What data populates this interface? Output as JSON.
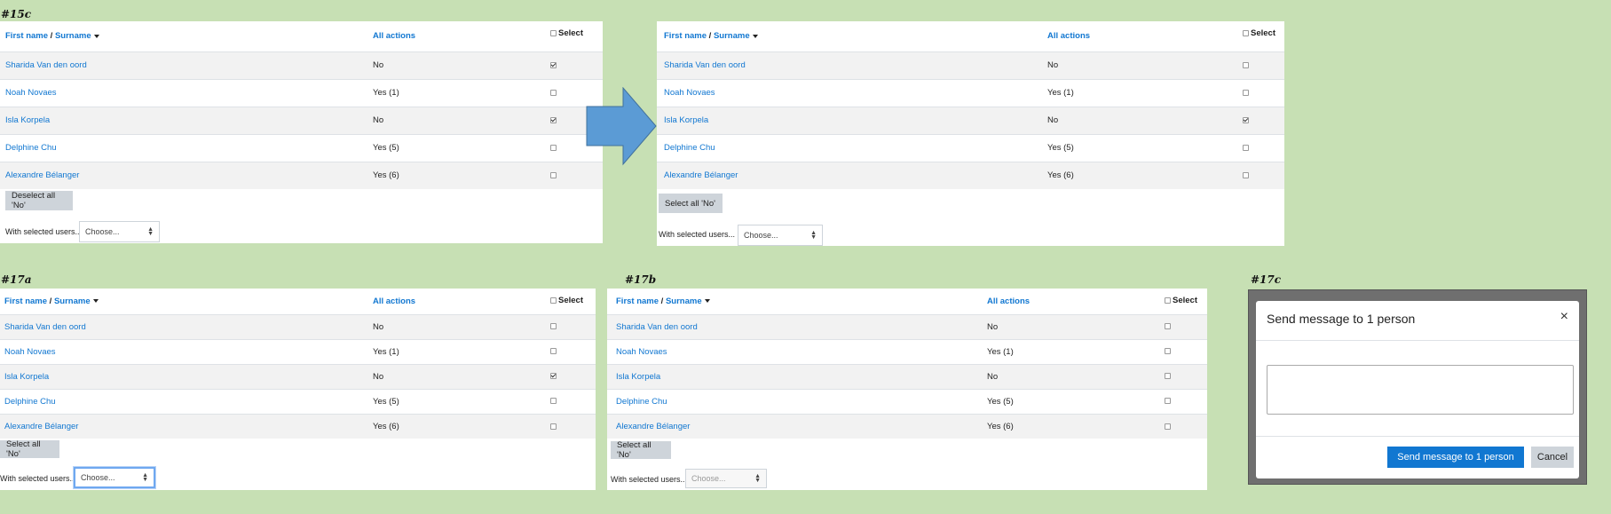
{
  "columns": {
    "first_name": "First name",
    "slash": " / ",
    "surname": "Surname",
    "all_actions": "All actions",
    "select": "Select"
  },
  "with_selected_label": "With selected users...",
  "choose_placeholder": "Choose...",
  "panels": {
    "p15c_left": {
      "caption": "#15c",
      "button": "Deselect all 'No'",
      "rows": [
        {
          "name": "Sharida Van den oord",
          "actions": "No",
          "checked": true
        },
        {
          "name": "Noah Novaes",
          "actions": "Yes (1)",
          "checked": false
        },
        {
          "name": "Isla Korpela",
          "actions": "No",
          "checked": true
        },
        {
          "name": "Delphine Chu",
          "actions": "Yes (5)",
          "checked": false
        },
        {
          "name": "Alexandre Bélanger",
          "actions": "Yes (6)",
          "checked": false
        }
      ]
    },
    "p15c_right": {
      "button": "Select all 'No'",
      "rows": [
        {
          "name": "Sharida Van den oord",
          "actions": "No",
          "checked": false
        },
        {
          "name": "Noah Novaes",
          "actions": "Yes (1)",
          "checked": false
        },
        {
          "name": "Isla Korpela",
          "actions": "No",
          "checked": true
        },
        {
          "name": "Delphine Chu",
          "actions": "Yes (5)",
          "checked": false
        },
        {
          "name": "Alexandre Bélanger",
          "actions": "Yes (6)",
          "checked": false
        }
      ]
    },
    "p17a": {
      "caption": "#17a",
      "button": "Select all 'No'",
      "rows": [
        {
          "name": "Sharida Van den oord",
          "actions": "No",
          "checked": false
        },
        {
          "name": "Noah Novaes",
          "actions": "Yes (1)",
          "checked": false
        },
        {
          "name": "Isla Korpela",
          "actions": "No",
          "checked": true
        },
        {
          "name": "Delphine Chu",
          "actions": "Yes (5)",
          "checked": false
        },
        {
          "name": "Alexandre Bélanger",
          "actions": "Yes (6)",
          "checked": false
        }
      ]
    },
    "p17b": {
      "caption": "#17b",
      "button": "Select all 'No'",
      "rows": [
        {
          "name": "Sharida Van den oord",
          "actions": "No",
          "checked": false
        },
        {
          "name": "Noah Novaes",
          "actions": "Yes (1)",
          "checked": false
        },
        {
          "name": "Isla Korpela",
          "actions": "No",
          "checked": false
        },
        {
          "name": "Delphine Chu",
          "actions": "Yes (5)",
          "checked": false
        },
        {
          "name": "Alexandre Bélanger",
          "actions": "Yes (6)",
          "checked": false
        }
      ]
    }
  },
  "modal": {
    "caption": "#17c",
    "title": "Send message to 1 person",
    "close_symbol": "×",
    "send_button": "Send message to 1 person",
    "cancel_button": "Cancel"
  },
  "colors": {
    "background": "#c7e0b4",
    "link": "#1177d1",
    "arrow": "#5b9bd5",
    "primary": "#1177d1"
  }
}
